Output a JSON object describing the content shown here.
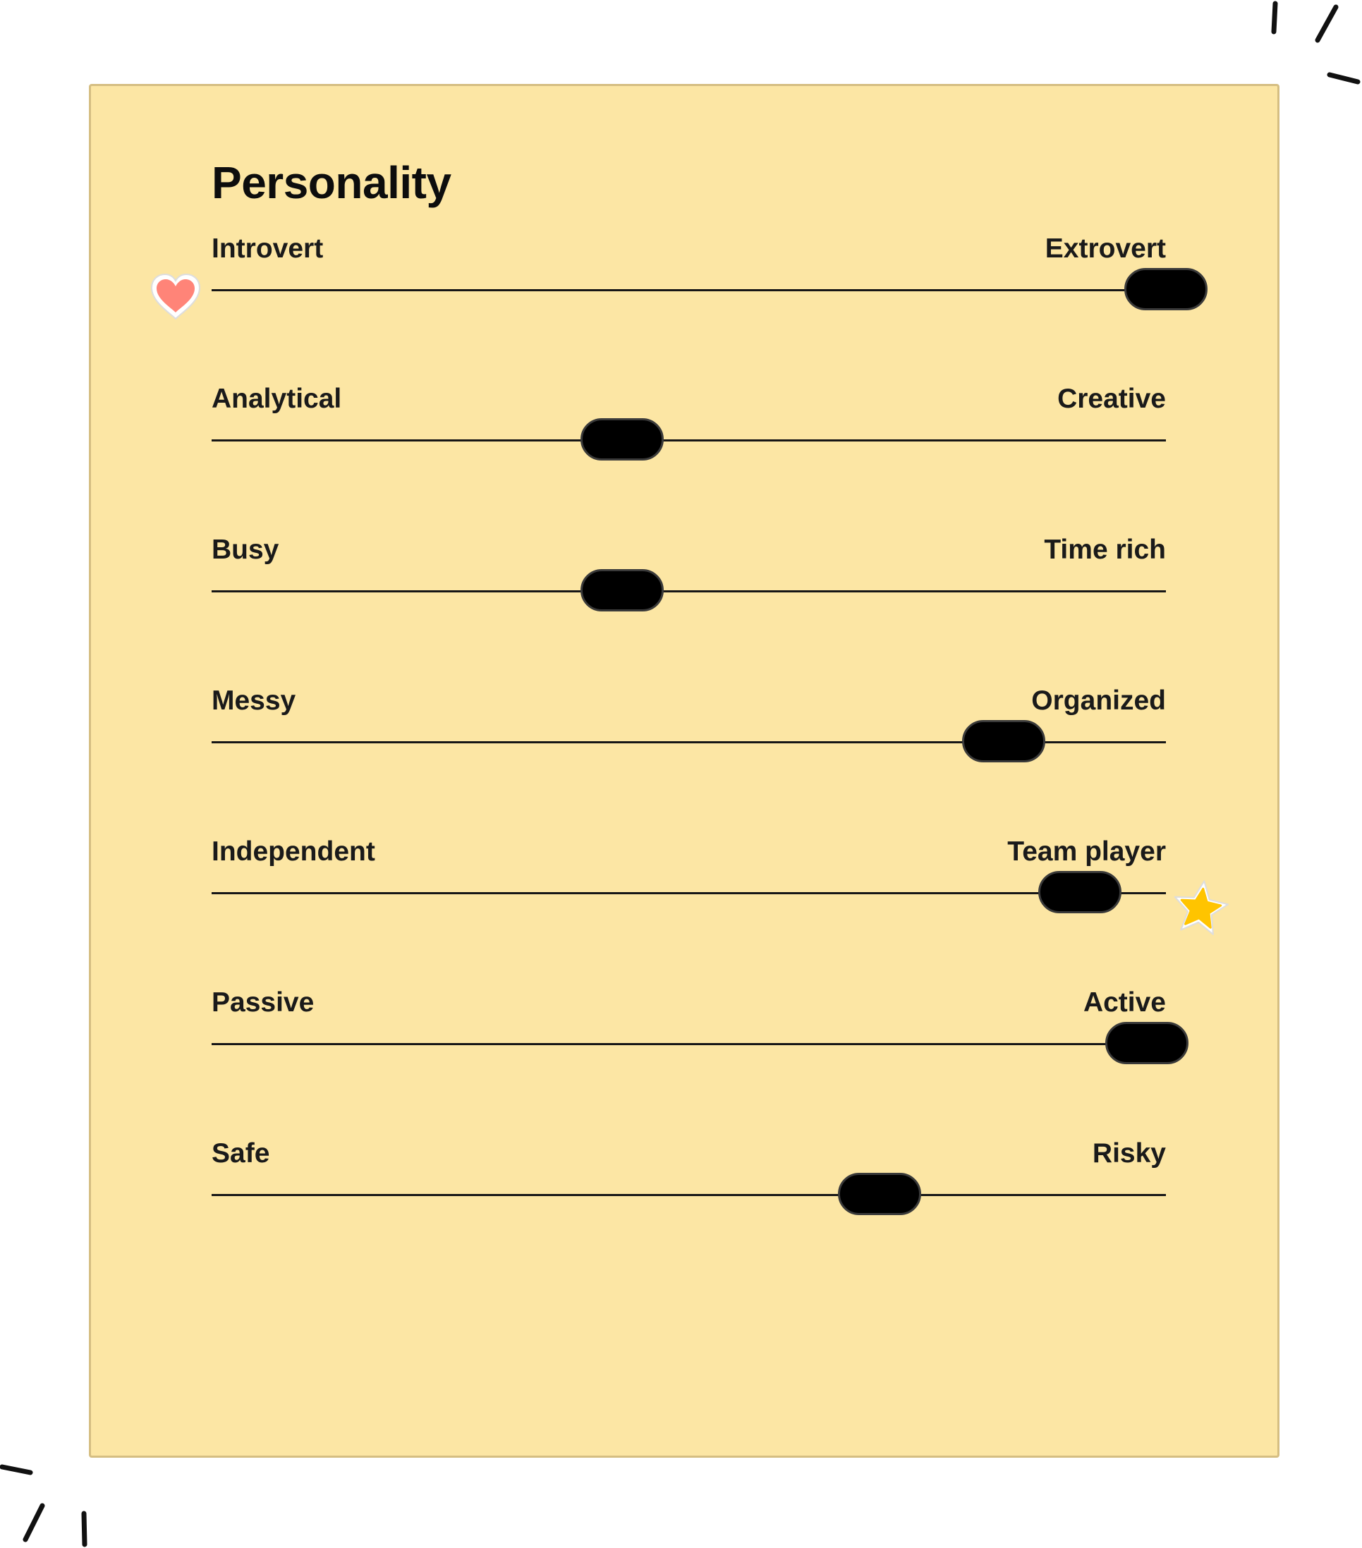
{
  "card": {
    "title": "Personality",
    "background_color": "#FCE6A4",
    "border_color": "#D5BE82"
  },
  "sliders": [
    {
      "left_label": "Introvert",
      "right_label": "Extrovert",
      "value": 1.0
    },
    {
      "left_label": "Analytical",
      "right_label": "Creative",
      "value": 0.43
    },
    {
      "left_label": "Busy",
      "right_label": "Time rich",
      "value": 0.43
    },
    {
      "left_label": "Messy",
      "right_label": "Organized",
      "value": 0.83
    },
    {
      "left_label": "Independent",
      "right_label": "Team player",
      "value": 0.91
    },
    {
      "left_label": "Passive",
      "right_label": "Active",
      "value": 0.98
    },
    {
      "left_label": "Safe",
      "right_label": "Risky",
      "value": 0.7
    }
  ],
  "stickers": {
    "heart": {
      "icon": "heart-icon",
      "color": "#FF8478"
    },
    "star": {
      "icon": "star-icon",
      "color": "#FFC400"
    }
  },
  "decorations": {
    "icon": "sparkle-lines-icon",
    "color": "#111111"
  }
}
